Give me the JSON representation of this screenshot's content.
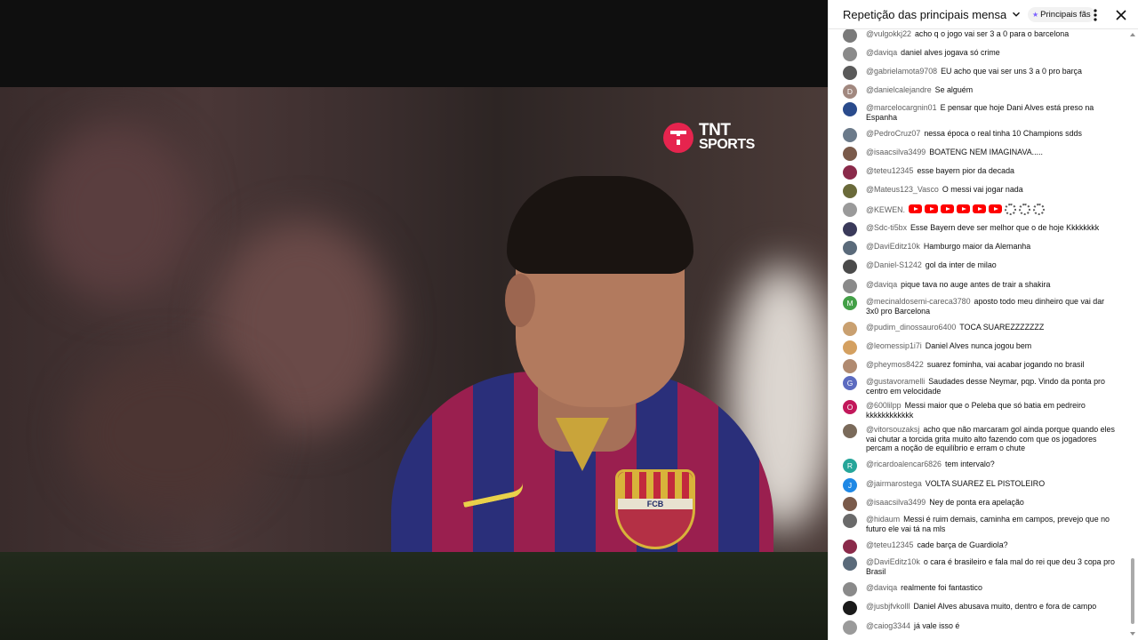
{
  "video": {
    "logo_line1": "TNT",
    "logo_line2": "SPORTS",
    "crest_text": "FCB"
  },
  "chat": {
    "title": "Repetição das principais mensagens ...",
    "filter_label": "Principais fãs",
    "icons": {
      "title_dropdown": "chevron-down-icon",
      "more": "more-vert-icon",
      "close": "close-icon"
    },
    "messages": [
      {
        "author": "@vulgokkj22",
        "text": "acho q o jogo vai ser 3 a 0 para o barcelona",
        "avatar_color": "#7a7a7a",
        "avatar_letter": ""
      },
      {
        "author": "@daviqa",
        "text": "daniel alves jogava só crime",
        "avatar_color": "#8a8a8a",
        "avatar_letter": ""
      },
      {
        "author": "@gabrielamota9708",
        "text": "EU acho que vai ser uns 3 a 0 pro barça",
        "avatar_color": "#5a5a5a",
        "avatar_letter": ""
      },
      {
        "author": "@danielcalejandre",
        "text": "Se alguém",
        "avatar_color": "#a1887f",
        "avatar_letter": "D"
      },
      {
        "author": "@marcelocargnin01",
        "text": "E pensar que hoje Dani Alves está preso na Espanha",
        "avatar_color": "#2a4b8c",
        "avatar_letter": ""
      },
      {
        "author": "@PedroCruz07",
        "text": "nessa época o real tinha 10 Champions sdds",
        "avatar_color": "#6b7a8a",
        "avatar_letter": ""
      },
      {
        "author": "@isaacsilva3499",
        "text": "BOATENG NEM IMAGINAVA.....",
        "avatar_color": "#7a5a4a",
        "avatar_letter": ""
      },
      {
        "author": "@teteu12345",
        "text": "esse bayern pior da decada",
        "avatar_color": "#8a2a4a",
        "avatar_letter": ""
      },
      {
        "author": "@Mateus123_Vasco",
        "text": "O messi vai jogar nada",
        "avatar_color": "#6a6a3a",
        "avatar_letter": ""
      },
      {
        "author": "@KEWEN.",
        "text": "",
        "avatar_color": "#9a9a9a",
        "avatar_letter": "",
        "emotes": [
          "youtube-badge",
          "youtube-badge",
          "youtube-badge",
          "youtube-badge",
          "youtube-badge",
          "youtube-badge",
          "soccer-ball-emoji",
          "soccer-ball-emoji",
          "soccer-ball-emoji"
        ]
      },
      {
        "author": "@Sdc-ti5bx",
        "text": "Esse Bayern deve ser melhor que o de hoje Kkkkkkkk",
        "avatar_color": "#3a3a5a",
        "avatar_letter": ""
      },
      {
        "author": "@DaviEditz10k",
        "text": "Hamburgo maior da Alemanha",
        "avatar_color": "#5a6a7a",
        "avatar_letter": ""
      },
      {
        "author": "@Daniel-S1242",
        "text": "gol da inter de milao",
        "avatar_color": "#4a4a4a",
        "avatar_letter": ""
      },
      {
        "author": "@daviqa",
        "text": "pique tava no auge antes de trair a shakira",
        "avatar_color": "#8a8a8a",
        "avatar_letter": ""
      },
      {
        "author": "@mecinaldosemi-careca3780",
        "text": "aposto todo meu dinheiro que vai dar 3x0 pro Barcelona",
        "avatar_color": "#43a047",
        "avatar_letter": "M"
      },
      {
        "author": "@pudim_dinossauro6400",
        "text": "TOCA SUAREZZZZZZZ",
        "avatar_color": "#c9a070",
        "avatar_letter": ""
      },
      {
        "author": "@leomessip1i7i",
        "text": "Daniel Alves nunca jogou bem",
        "avatar_color": "#d4a060",
        "avatar_letter": ""
      },
      {
        "author": "@pheymos8422",
        "text": "suarez fominha, vai acabar jogando no brasil",
        "avatar_color": "#b08a70",
        "avatar_letter": ""
      },
      {
        "author": "@gustavoramelli",
        "text": "Saudades desse Neymar, pqp. Vindo da ponta pro centro em velocidade",
        "avatar_color": "#5c6bc0",
        "avatar_letter": "G"
      },
      {
        "author": "@600lilpp",
        "text": "Messi maior que o Peleba que só batia em pedreiro kkkkkkkkkkkk",
        "avatar_color": "#c2185b",
        "avatar_letter": "O"
      },
      {
        "author": "@vitorsouzaksj",
        "text": "acho que não marcaram gol ainda porque quando eles vai chutar a torcida grita muito alto fazendo com que os jogadores percam a noção de equilíbrio e erram o chute",
        "avatar_color": "#7a6a5a",
        "avatar_letter": ""
      },
      {
        "author": "@ricardoalencar6826",
        "text": "tem intervalo?",
        "avatar_color": "#26a69a",
        "avatar_letter": "R"
      },
      {
        "author": "@jairmarostega",
        "text": "VOLTA SUAREZ EL PISTOLEIRO",
        "avatar_color": "#1e88e5",
        "avatar_letter": "J"
      },
      {
        "author": "@isaacsilva3499",
        "text": "Ney de ponta era apelação",
        "avatar_color": "#7a5a4a",
        "avatar_letter": ""
      },
      {
        "author": "@hidaum",
        "text": "Messi é ruim demais, caminha em campos, prevejo que no futuro ele vai tá na mls",
        "avatar_color": "#6a6a6a",
        "avatar_letter": ""
      },
      {
        "author": "@teteu12345",
        "text": "cade barça de Guardiola?",
        "avatar_color": "#8a2a4a",
        "avatar_letter": ""
      },
      {
        "author": "@DaviEditz10k",
        "text": "o cara é brasileiro e fala mal do rei que deu 3 copa pro Brasil",
        "avatar_color": "#5a6a7a",
        "avatar_letter": ""
      },
      {
        "author": "@daviqa",
        "text": "realmente foi fantastico",
        "avatar_color": "#8a8a8a",
        "avatar_letter": ""
      },
      {
        "author": "@jusbjfvkolll",
        "text": "Daniel Alves abusava muito, dentro e fora de campo",
        "avatar_color": "#1a1a1a",
        "avatar_letter": ""
      },
      {
        "author": "@caiog3344",
        "text": "já vale isso é",
        "avatar_color": "#9a9a9a",
        "avatar_letter": ""
      }
    ]
  }
}
